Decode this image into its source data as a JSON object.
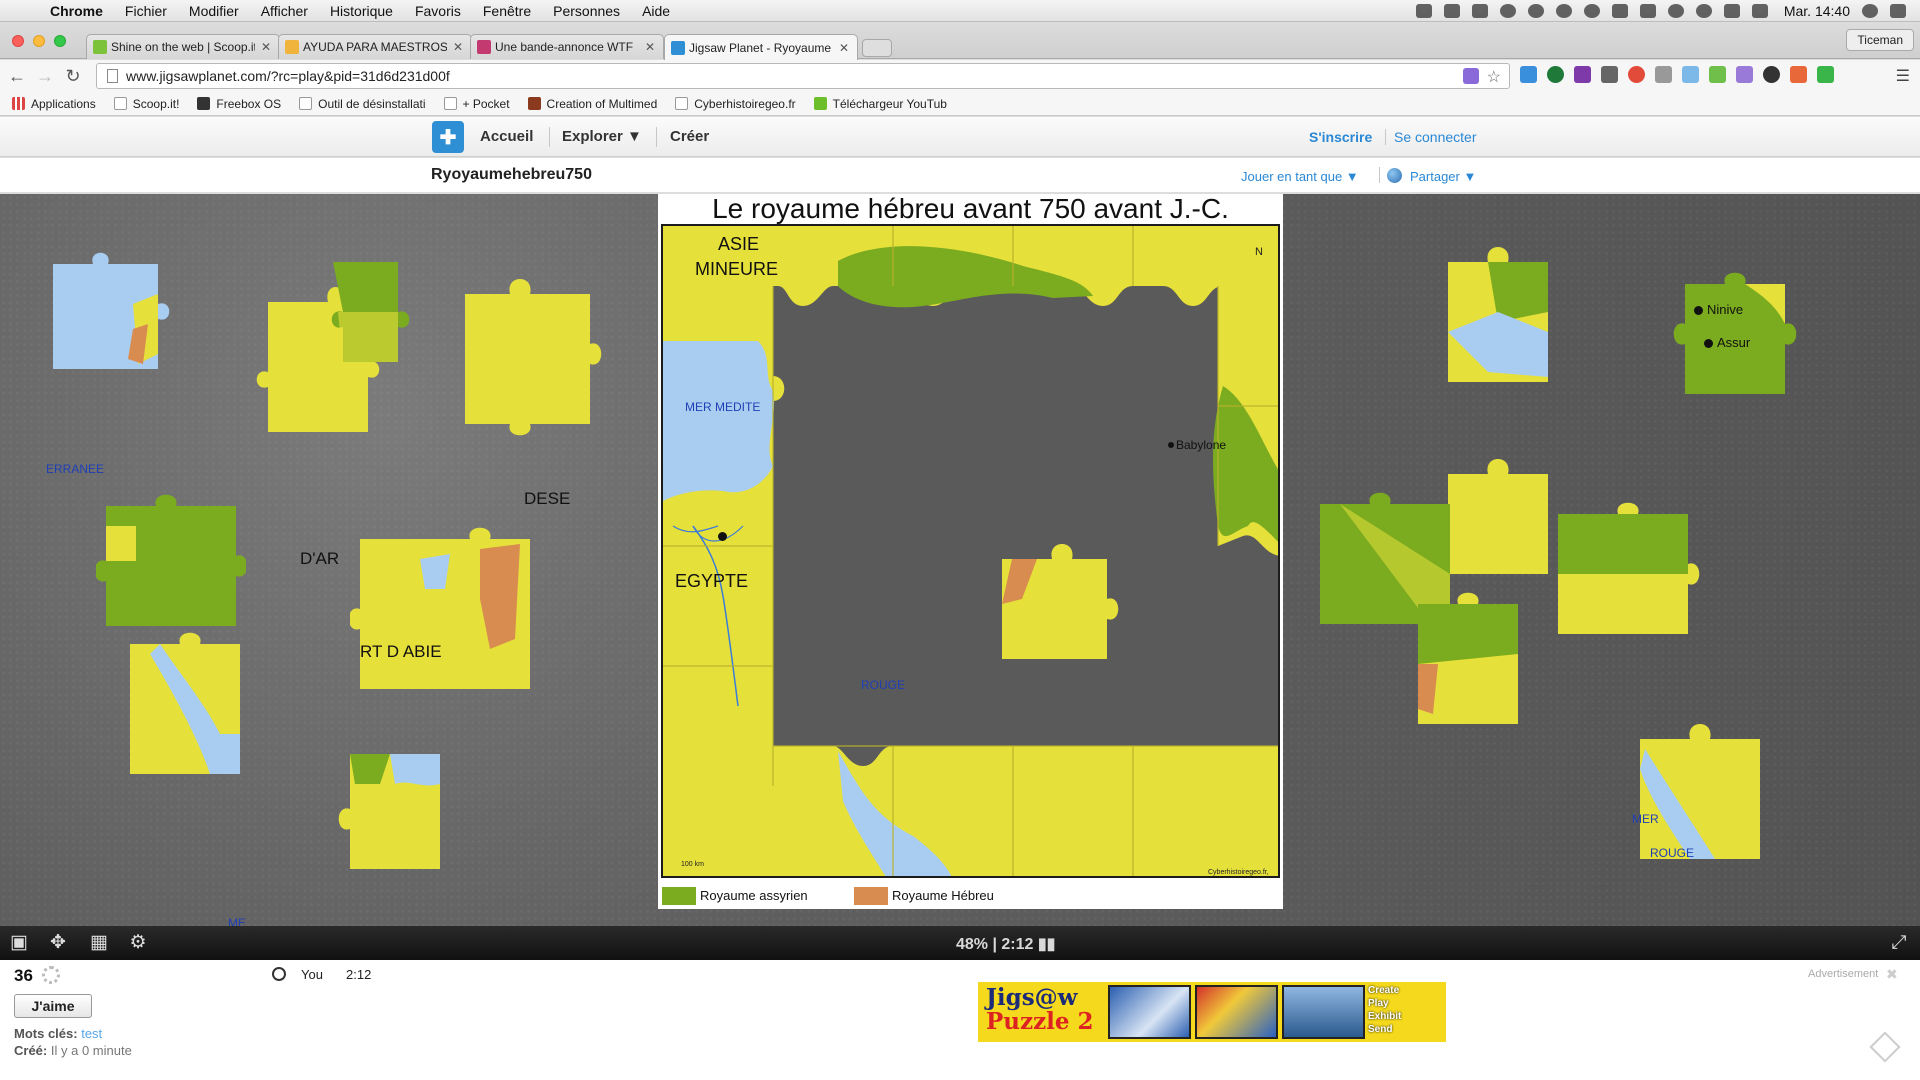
{
  "menubar": {
    "app": "Chrome",
    "items": [
      "Fichier",
      "Modifier",
      "Afficher",
      "Historique",
      "Favoris",
      "Fenêtre",
      "Personnes",
      "Aide"
    ],
    "clock": "Mar. 14:40"
  },
  "tabs": [
    {
      "title": "Shine on the web | Scoop.it",
      "active": false
    },
    {
      "title": "AYUDA PARA MAESTROS",
      "active": false
    },
    {
      "title": "Une bande-annonce WTF",
      "active": false
    },
    {
      "title": "Jigsaw Planet - Ryoyaume",
      "active": true
    }
  ],
  "profile": "Ticeman",
  "url": "www.jigsawplanet.com/?rc=play&pid=31d6d231d00f",
  "bookmarks": [
    "Applications",
    "Scoop.it!",
    "Freebox OS",
    "Outil de désinstallati",
    "+ Pocket",
    "Creation of Multimed",
    "Cyberhistoiregeo.fr",
    "Téléchargeur YouTub"
  ],
  "site": {
    "nav": [
      "Accueil",
      "Explorer ▼",
      "Créer"
    ],
    "signup": "S'inscrire",
    "login": "Se connecter",
    "puzzle_title": "Ryoyaumehebreu750",
    "play_as": "Jouer en tant que ▼",
    "share": "Partager ▼"
  },
  "map": {
    "title": "Le royaume hébreu avant 750 avant J.-C.",
    "labels": {
      "asie": "ASIE",
      "mineure": "MINEURE",
      "north": "N",
      "mer_medit": "MER MEDITE",
      "babylone": "Babylone",
      "egypte": "EGYPTE",
      "rouge": "ROUGE",
      "scale": "100 km",
      "credit": "Cyberhistoiregeo.fr, 2012"
    },
    "legend": [
      {
        "label": "Royaume assyrien",
        "color": "#7bab1f"
      },
      {
        "label": "Royaume Hébreu",
        "color": "#d98c4f"
      }
    ]
  },
  "loose_labels": {
    "erranee": "ERRANEE",
    "dese": "DESE",
    "oar": "D'AR",
    "rtabie": "RT D  ABIE",
    "me": "ME",
    "ninive": "Ninive",
    "assur": "Assur",
    "mer": "MER",
    "rouge2": "ROUGE"
  },
  "colors": {
    "yellow": "#e6e03a",
    "green": "#7bab1f",
    "blue": "#a9cdf1",
    "orange": "#d98c4f"
  },
  "controls": {
    "progress": "48% | 2:12 ▮▮"
  },
  "footer": {
    "pieces": "36",
    "you": "You",
    "time": "2:12",
    "like": "J'aime",
    "keywords_label": "Mots clés:",
    "keywords_value": "test",
    "created_label": "Créé:",
    "created_value": "Il y a 0 minute",
    "ad_label": "Advertisement",
    "banner": {
      "logo": "Jigs@w",
      "logo2": "Puzzle 2",
      "actions": [
        "Create",
        "Play",
        "Exhibit",
        "Send"
      ]
    }
  }
}
